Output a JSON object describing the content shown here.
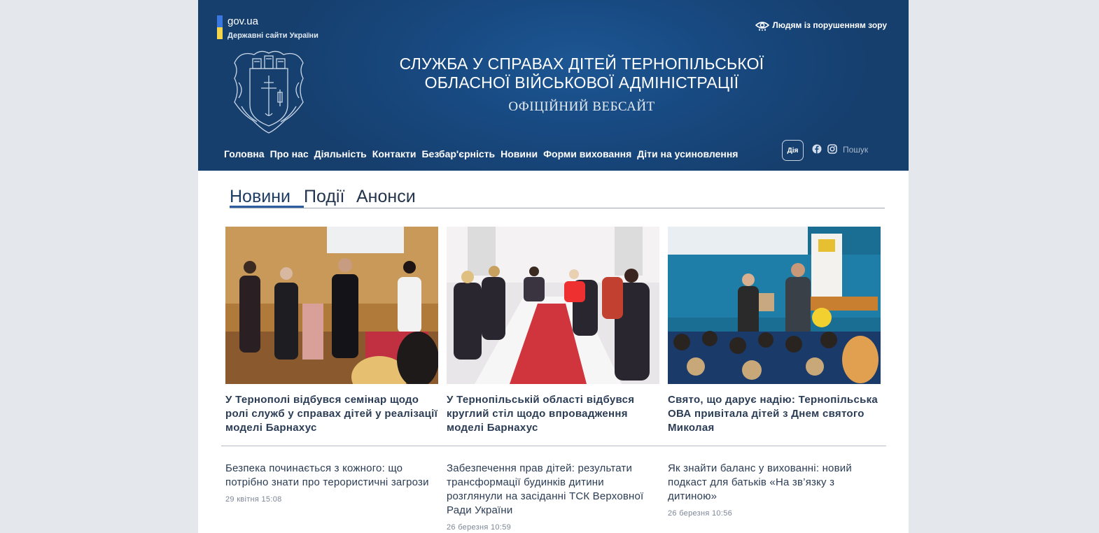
{
  "gov": {
    "domain": "gov.ua",
    "subtitle": "Державні сайти України"
  },
  "accessibility": {
    "label": "Людям із порушенням зору",
    "icon": "eye-hand-icon"
  },
  "org": {
    "title_line1": "СЛУЖБА У СПРАВАХ ДІТЕЙ ТЕРНОПІЛЬСЬКОЇ",
    "title_line2": "ОБЛАСНОЇ ВІЙСЬКОВОЇ АДМІНІСТРАЦІЇ",
    "subtitle": "ОФІЦІЙНИЙ ВЕБСАЙТ"
  },
  "nav": [
    "Головна",
    "Про нас",
    "Діяльність",
    "Контакти",
    "Безбар'єрність",
    "Новини",
    "Форми виховання",
    "Діти на усиновлення"
  ],
  "header_tools": {
    "diia": "Дія",
    "search": "Пошук"
  },
  "tabs": [
    "Новини",
    "Події",
    "Анонси"
  ],
  "featured": [
    {
      "title": "У Тернополі відбувся семінар щодо ролі служб у справах дітей у реалізації моделі Барнахус"
    },
    {
      "title": "У Тернопільській області відбувся круглий стіл щодо впровадження моделі Барнахус"
    },
    {
      "title": "Свято, що дарує надію: Тернопільська ОВА привітала дітей з Днем святого Миколая"
    }
  ],
  "news": [
    {
      "title": "Безпека починається з кожного: що потрібно знати про терористичні загрози",
      "date": "29 квітня 15:08"
    },
    {
      "title": "Забезпечення прав дітей: результати трансформації будинків дитини розглянули на засіданні ТСК Верховної Ради України",
      "date": "26 березня 10:59"
    },
    {
      "title": "Як знайти баланс у вихованні: новий подкаст для батьків «На зв’язку з дитиною»",
      "date": "26 березня 10:56"
    }
  ],
  "colors": {
    "header": "#184a82",
    "accent": "#2e5ea0",
    "text": "#2b3c55"
  }
}
